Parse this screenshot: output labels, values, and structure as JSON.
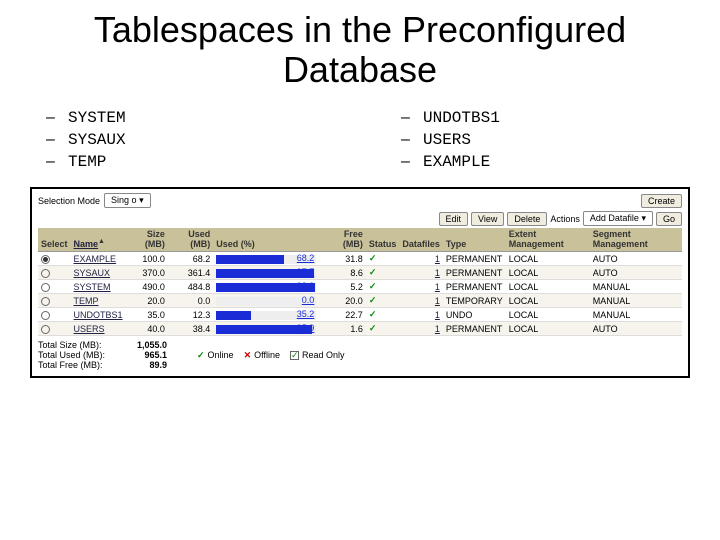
{
  "title": "Tablespaces in the Preconfigured Database",
  "left_list": [
    "SYSTEM",
    "SYSAUX",
    "TEMP"
  ],
  "right_list": [
    "UNDOTBS1",
    "USERS",
    "EXAMPLE"
  ],
  "toolbar": {
    "selection_mode_label": "Selection Mode",
    "selection_mode_value": "Sing o",
    "create_label": "Create",
    "edit_label": "Edit",
    "view_label": "View",
    "delete_label": "Delete",
    "actions_label": "Actions",
    "actions_value": "Add Datafile",
    "go_label": "Go"
  },
  "headers": {
    "select": "Select",
    "name": "Name",
    "size": "Size (MB)",
    "used": "Used (MB)",
    "used_pct": "Used (%)",
    "free": "Free (MB)",
    "status": "Status",
    "datafiles": "Datafiles",
    "type": "Type",
    "extent": "Extent Management",
    "segment": "Segment Management"
  },
  "rows": [
    {
      "sel": true,
      "name": "EXAMPLE",
      "size": "100.0",
      "used": "68.2",
      "pct": 68.2,
      "pct_label": "68.2",
      "free": "31.8",
      "status": "on",
      "datafiles": "1",
      "type": "PERMANENT",
      "extent": "LOCAL",
      "segment": "AUTO"
    },
    {
      "sel": false,
      "name": "SYSAUX",
      "size": "370.0",
      "used": "361.4",
      "pct": 97.7,
      "pct_label": "97.7",
      "free": "8.6",
      "status": "on",
      "datafiles": "1",
      "type": "PERMANENT",
      "extent": "LOCAL",
      "segment": "AUTO"
    },
    {
      "sel": false,
      "name": "SYSTEM",
      "size": "490.0",
      "used": "484.8",
      "pct": 98.9,
      "pct_label": "98.9",
      "free": "5.2",
      "status": "on",
      "datafiles": "1",
      "type": "PERMANENT",
      "extent": "LOCAL",
      "segment": "MANUAL"
    },
    {
      "sel": false,
      "name": "TEMP",
      "size": "20.0",
      "used": "0.0",
      "pct": 0.0,
      "pct_label": "0.0",
      "free": "20.0",
      "status": "on",
      "datafiles": "1",
      "type": "TEMPORARY",
      "extent": "LOCAL",
      "segment": "MANUAL"
    },
    {
      "sel": false,
      "name": "UNDOTBS1",
      "size": "35.0",
      "used": "12.3",
      "pct": 35.2,
      "pct_label": "35.2",
      "free": "22.7",
      "status": "on",
      "datafiles": "1",
      "type": "UNDO",
      "extent": "LOCAL",
      "segment": "MANUAL"
    },
    {
      "sel": false,
      "name": "USERS",
      "size": "40.0",
      "used": "38.4",
      "pct": 95.9,
      "pct_label": "95.9",
      "free": "1.6",
      "status": "on",
      "datafiles": "1",
      "type": "PERMANENT",
      "extent": "LOCAL",
      "segment": "AUTO"
    }
  ],
  "totals": {
    "total_size_label": "Total Size (MB):",
    "total_size_value": "1,055.0",
    "total_used_label": "Total Used (MB):",
    "total_used_value": "965.1",
    "total_free_label": "Total Free (MB):",
    "total_free_value": "89.9"
  },
  "legend": {
    "online": "Online",
    "offline": "Offline",
    "readonly": "Read Only"
  }
}
